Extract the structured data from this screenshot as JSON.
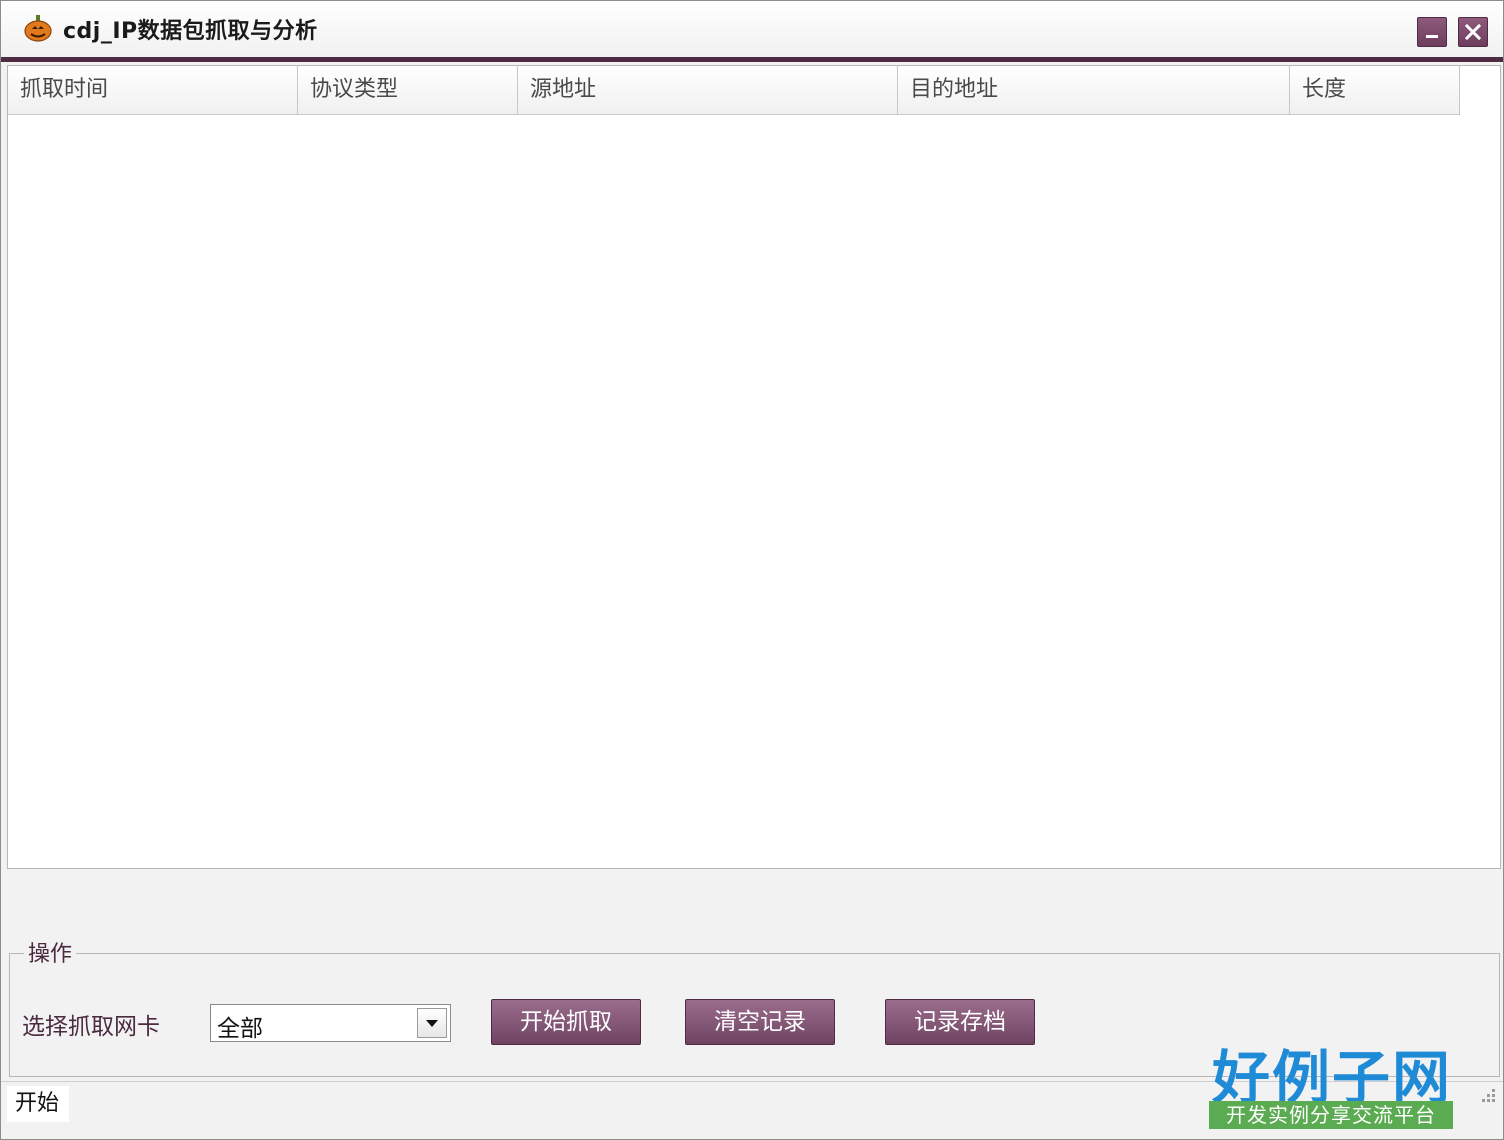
{
  "window": {
    "title": "cdj_IP数据包抓取与分析",
    "accent_color": "#6e3e5d",
    "icon": "pumpkin-icon"
  },
  "packet_list": {
    "columns": [
      {
        "label": "抓取时间"
      },
      {
        "label": "协议类型"
      },
      {
        "label": "源地址"
      },
      {
        "label": "目的地址"
      },
      {
        "label": "长度"
      }
    ],
    "rows": []
  },
  "operations": {
    "legend": "操作",
    "nic_label": "选择抓取网卡",
    "nic_selected": "全部",
    "buttons": {
      "start": "开始抓取",
      "clear": "清空记录",
      "save": "记录存档"
    }
  },
  "status": {
    "text": "开始"
  },
  "watermark": {
    "title": "好例子网",
    "subtitle": "开发实例分享交流平台"
  }
}
